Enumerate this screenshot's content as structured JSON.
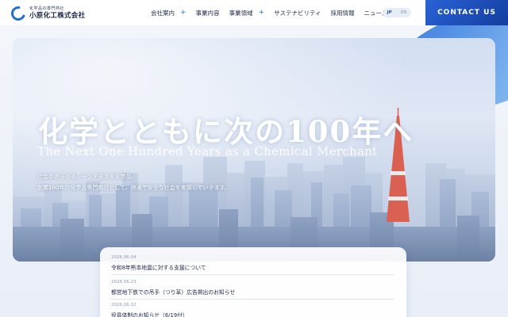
{
  "header": {
    "logo_tagline": "化学品の専門商社",
    "logo_name": "小原化工株式会社",
    "nav": [
      {
        "label": "会社案内",
        "has_plus": true
      },
      {
        "label": "事業内容",
        "has_plus": false
      },
      {
        "label": "事業領域",
        "has_plus": true
      },
      {
        "label": "サステナビリティ",
        "has_plus": false
      },
      {
        "label": "採用情報",
        "has_plus": false
      },
      {
        "label": "ニュース",
        "has_plus": false
      }
    ],
    "lang_jp": "JP",
    "lang_en": "EN",
    "contact_label": "CONTACT US"
  },
  "hero": {
    "title": "化学とともに次の100年へ",
    "subtitle": "The Next One Hundred Years as a Chemical Merchant",
    "lead_1": "社会のあらゆるシーンを支える化学品。",
    "lead_2": "創業100年の化学品専門商社として、快適で安全な社会を実現していきます。"
  },
  "news": [
    {
      "date": "2026.06.04",
      "title": "令和8年熊本地震に対する支援について"
    },
    {
      "date": "2026.06.23",
      "title": "都営地下鉄での吊手（つり革）広告掲出のお知らせ"
    },
    {
      "date": "2026.06.22",
      "title": "役員体制のお知らせ（6/19付）"
    }
  ],
  "colors": {
    "accent": "#2a63d6",
    "accent_dark": "#143d9e",
    "text": "#1b2a4a"
  }
}
